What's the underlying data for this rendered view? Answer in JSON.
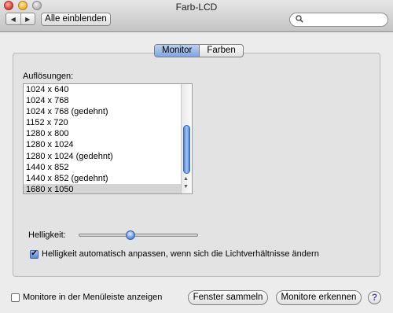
{
  "window": {
    "title": "Farb-LCD"
  },
  "toolbar": {
    "back_icon": "◀",
    "forward_icon": "▶",
    "show_all_label": "Alle einblenden",
    "search_icon": "🔍",
    "search_value": "",
    "search_placeholder": ""
  },
  "tabs": [
    {
      "label": "Monitor",
      "selected": true
    },
    {
      "label": "Farben",
      "selected": false
    }
  ],
  "resolutions": {
    "label": "Auflösungen:",
    "items": [
      "1024 x 640",
      "1024 x 768",
      "1024 x 768 (gedehnt)",
      "1152 x 720",
      "1280 x 800",
      "1280 x 1024",
      "1280 x 1024 (gedehnt)",
      "1440 x 852",
      "1440 x 852 (gedehnt)",
      "1680 x 1050"
    ],
    "selected_index": 9
  },
  "brightness": {
    "label": "Helligkeit:",
    "level": 0.43
  },
  "auto_brightness": {
    "label": "Helligkeit automatisch anpassen, wenn sich die Lichtverhältnisse ändern",
    "checked": true,
    "check_glyph": "✔"
  },
  "footer": {
    "show_in_menubar_label": "Monitore in der Menüleiste anzeigen",
    "show_in_menubar_checked": false,
    "gather_windows_label": "Fenster sammeln",
    "detect_displays_label": "Monitore erkennen",
    "help_glyph": "?"
  },
  "colors": {
    "accent": "#6b9bea"
  }
}
